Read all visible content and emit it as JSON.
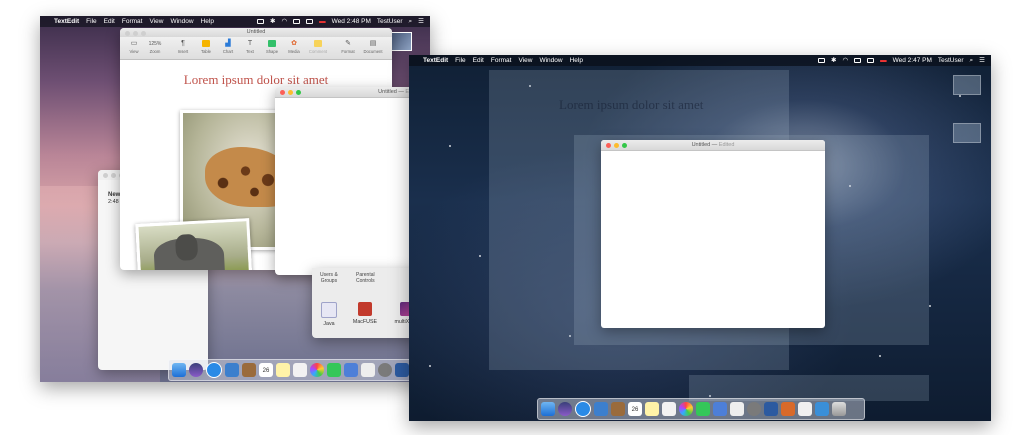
{
  "left_screen": {
    "menubar": {
      "app_name": "TextEdit",
      "menus": [
        "File",
        "Edit",
        "Format",
        "View",
        "Window",
        "Help"
      ],
      "clock": "Wed 2:48 PM",
      "user": "TestUser"
    },
    "pages_window": {
      "title": "Untitled",
      "toolbar": [
        {
          "label": "View",
          "icon": "view-icon"
        },
        {
          "label": "Zoom",
          "value": "125%",
          "icon": "zoom-icon"
        },
        {
          "label": "Insert",
          "icon": "paragraph-icon"
        },
        {
          "label": "Table",
          "icon": "table-icon"
        },
        {
          "label": "Chart",
          "icon": "chart-icon"
        },
        {
          "label": "Text",
          "icon": "text-icon"
        },
        {
          "label": "Shape",
          "icon": "shape-icon"
        },
        {
          "label": "Media",
          "icon": "media-icon"
        },
        {
          "label": "Comment",
          "icon": "comment-icon"
        },
        {
          "label": "Format",
          "icon": "format-brush-icon"
        },
        {
          "label": "Document",
          "icon": "document-icon"
        }
      ],
      "heading": "Lorem ipsum dolor sit amet"
    },
    "notes_window": {
      "line1": "New",
      "line2": "2:48"
    },
    "untitled_window": {
      "title": "Untitled",
      "status": "Edited"
    },
    "prefs_window": {
      "top_items": [
        {
          "line1": "Users &",
          "line2": "Groups"
        },
        {
          "line1": "Parental",
          "line2": "Controls"
        }
      ],
      "items": [
        "Java",
        "MacFUSE",
        "multiXFind"
      ]
    },
    "dock_calendar_day": "26"
  },
  "right_screen": {
    "menubar": {
      "app_name": "TextEdit",
      "menus": [
        "File",
        "Edit",
        "Format",
        "View",
        "Window",
        "Help"
      ],
      "clock": "Wed 2:47 PM",
      "user": "TestUser"
    },
    "ghost_heading": "Lorem ipsum dolor sit amet",
    "untitled_window": {
      "title": "Untitled",
      "status": "Edited"
    },
    "dock_calendar_day": "26"
  },
  "colors": {
    "accent_heading": "#c0534b",
    "close": "#fc5f57",
    "minimize": "#fdbc2e",
    "zoom": "#33c748"
  }
}
